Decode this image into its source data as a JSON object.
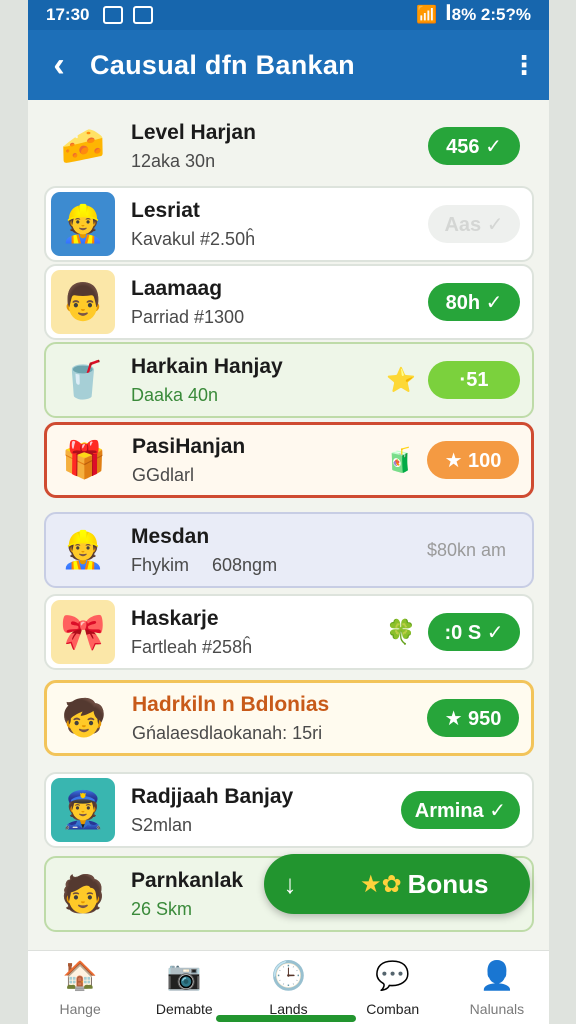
{
  "status_bar": {
    "time": "17:30",
    "right_text": "ꟾ8% 2:5?%"
  },
  "app_bar": {
    "title": "Causual dfn Bankan",
    "back_icon": "chevron-left-icon",
    "menu_icon": "kebab-menu-icon"
  },
  "rows": [
    {
      "name": "Level Harjan",
      "sub": "12aka 30n",
      "badge": "456 ✓",
      "style": "green",
      "avatar": "🧀"
    },
    {
      "name": "Lesriat",
      "sub": "Kavakul #2.50ĥ",
      "badge": "Aas ✓",
      "style": "faded",
      "avatar": "👷"
    },
    {
      "name": "Laamaag",
      "sub": "Parriad #1300",
      "badge": "80h ✓",
      "style": "green",
      "avatar": "👨"
    },
    {
      "name": "Harkain Hanjay",
      "sub": "Daaka 40n",
      "badge": "·51",
      "style": "lime",
      "avatar": "🥤",
      "deco": "⭐"
    },
    {
      "name": "PasiHanjan",
      "sub": "GGdlarl",
      "badge": "★ 100",
      "style": "orange",
      "avatar": "🎁",
      "deco": "🧃"
    },
    {
      "name": "Mesdan",
      "sub": "Fhykim",
      "extra": "608ngm",
      "badge": "$80kn am",
      "style": "plain",
      "avatar": "👷"
    },
    {
      "name": "Haskarje",
      "sub": "Fartleah #258ĥ",
      "badge": ":0 S ✓",
      "style": "green",
      "avatar": "🎀",
      "deco": "🍀"
    },
    {
      "name": "Hadrkiln n Bdlonias",
      "sub": "Gńalaesdlaokanah: 15ri",
      "badge": "★ 950",
      "style": "green",
      "avatar": "🧒"
    },
    {
      "name": "Radjjaah Banjay",
      "sub": "S2mlan",
      "badge": "Armina ✓",
      "style": "green",
      "avatar": "👮"
    },
    {
      "name": "Parnkanlak",
      "sub": "26 Skm",
      "badge": "",
      "style": "none",
      "avatar": "🧑"
    }
  ],
  "bonus": {
    "arrow": "↓",
    "stars": "★✿",
    "label": "Bonus"
  },
  "nav": [
    {
      "label": "Hange",
      "icon": "🏠"
    },
    {
      "label": "Demabte",
      "icon": "📷"
    },
    {
      "label": "Lands",
      "icon": "🕒"
    },
    {
      "label": "Comban",
      "icon": "💬"
    },
    {
      "label": "Nalunals",
      "icon": "👤"
    }
  ],
  "colors": {
    "primary": "#1d6fb8",
    "accent": "#27a53a",
    "highlight": "#cf4b31",
    "orange": "#f49a42"
  }
}
